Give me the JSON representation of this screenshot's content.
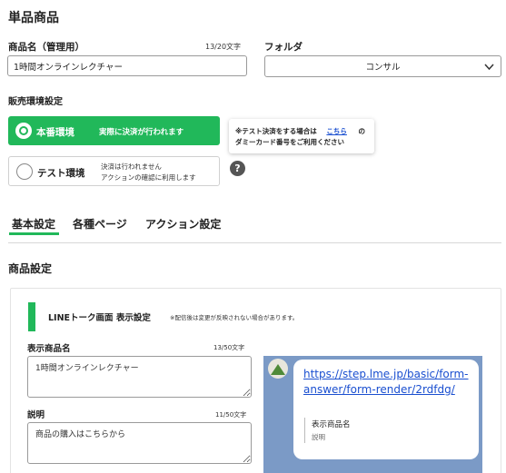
{
  "page": {
    "title": "単品商品"
  },
  "product_name": {
    "label": "商品名（管理用）",
    "counter": "13/20文字",
    "value": "1時間オンラインレクチャー"
  },
  "folder": {
    "label": "フォルダ",
    "selected": "コンサル"
  },
  "sales_env": {
    "label": "販売環境設定",
    "production": {
      "label": "本番環境",
      "desc": "実際に決済が行われます"
    },
    "test": {
      "label": "テスト環境",
      "desc_line1": "決済は行われません",
      "desc_line2": "アクションの確認に利用します"
    },
    "tip": {
      "line1_pre": "※テスト決済をする場合は",
      "link": "こちら",
      "line1_post": "の",
      "line2": "ダミーカード番号をご利用ください"
    },
    "help_icon": "?"
  },
  "tabs": [
    {
      "label": "基本設定",
      "active": true
    },
    {
      "label": "各種ページ",
      "active": false
    },
    {
      "label": "アクション設定",
      "active": false
    }
  ],
  "section": {
    "title": "商品設定"
  },
  "line_panel": {
    "title": "LINEトーク画面 表示設定",
    "note": "※配信後は変更が反映されない場合があります。",
    "display_name": {
      "label": "表示商品名",
      "counter": "13/50文字",
      "value": "1時間オンラインレクチャー"
    },
    "description": {
      "label": "説明",
      "counter": "11/50文字",
      "value": "商品の購入はこちらから"
    },
    "preview": {
      "url_line1": "https://step.lme.jp/basic/form-",
      "url_line2": "answer/form-render/2rdfdg/",
      "name": "表示商品名",
      "desc": "説明"
    }
  },
  "colors": {
    "accent": "#21b85a",
    "link": "#1a4fd0",
    "preview_bg": "#7b9ac6"
  }
}
